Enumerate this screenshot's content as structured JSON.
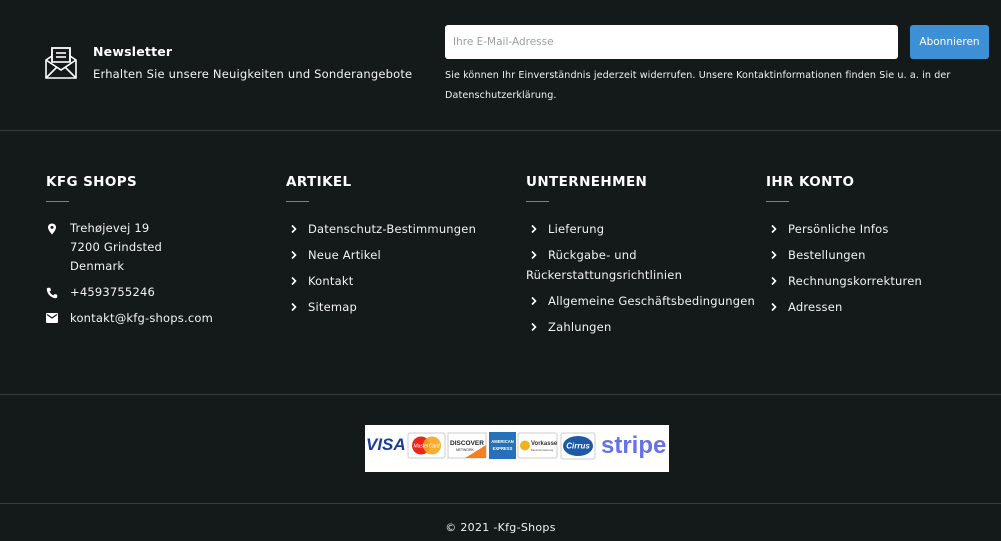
{
  "newsletter": {
    "title": "Newsletter",
    "subtitle": "Erhalten Sie unsere Neuigkeiten und Sonderangebote",
    "email_placeholder": "Ihre E-Mail-Adresse",
    "subscribe_label": "Abonnieren",
    "note": "Sie können Ihr Einverständnis jederzeit widerrufen. Unsere Kontaktinformationen finden Sie u. a. in der Datenschutzerklärung."
  },
  "columns": {
    "shop": {
      "title": "KFG SHOPS",
      "address_line1": "Trehøjevej 19",
      "address_line2": "7200 Grindsted",
      "address_line3": "Denmark",
      "phone": "+4593755246",
      "email": "kontakt@kfg-shops.com"
    },
    "artikel": {
      "title": "ARTIKEL",
      "items": [
        "Datenschutz-Bestimmungen",
        "Neue Artikel",
        "Kontakt",
        "Sitemap"
      ]
    },
    "unternehmen": {
      "title": "UNTERNEHMEN",
      "items": [
        "Lieferung",
        "Rückgabe- und Rückerstattungsrichtlinien",
        "Allgemeine Geschäftsbedingungen",
        "Zahlungen"
      ]
    },
    "konto": {
      "title": "IHR KONTO",
      "items": [
        "Persönliche Infos",
        "Bestellungen",
        "Rechnungskorrekturen",
        "Adressen"
      ]
    }
  },
  "payment": {
    "visa": "VISA",
    "mastercard": "MasterCard",
    "discover": "DISCOVER",
    "discover_sub": "NETWORK",
    "amex_line1": "AMERICAN",
    "amex_line2": "EXPRESS",
    "vorkasse": "Vorkasse",
    "vorkasse_sub": "Bankuberweisung",
    "cirrus": "Cirrus",
    "stripe": "stripe"
  },
  "footer": {
    "copyright": "© 2021 -Kfg-Shops"
  },
  "colors": {
    "background": "#141a1a",
    "accent": "#3d8fd6",
    "divider": "#363c3c"
  }
}
